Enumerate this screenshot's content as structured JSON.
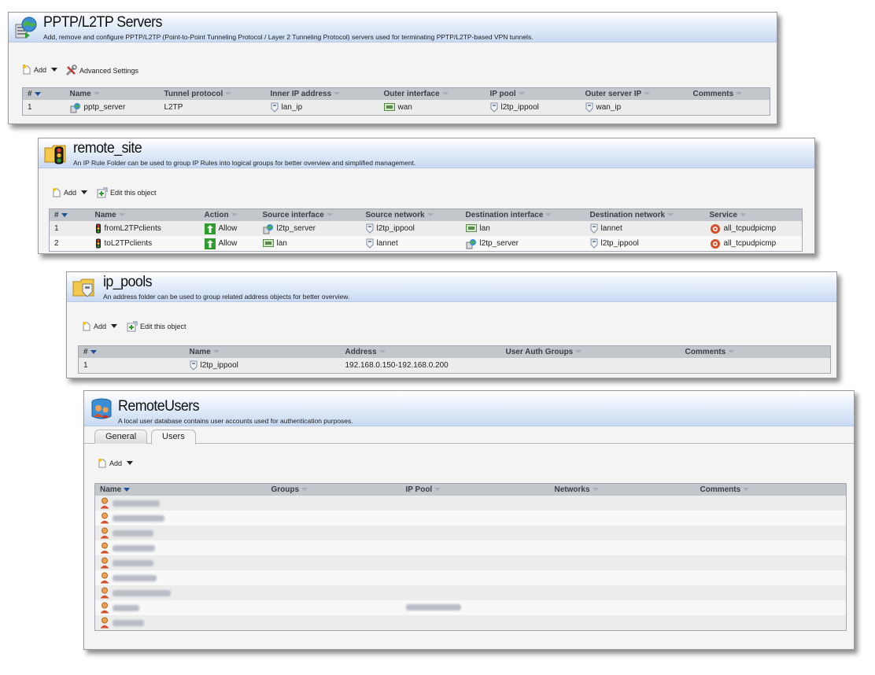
{
  "pptp_panel": {
    "title": "PPTP/L2TP Servers",
    "description": "Add, remove and configure PPTP/L2TP (Point-to-Point Tunneling Protocol / Layer 2 Tunneling Protocol) servers used for terminating PPTP/L2TP-based VPN tunnels.",
    "toolbar": {
      "add_label": "Add",
      "advanced_label": "Advanced Settings"
    },
    "columns": [
      "#",
      "Name",
      "Tunnel protocol",
      "Inner IP address",
      "Outer interface",
      "IP pool",
      "Outer server IP",
      "Comments"
    ],
    "rows": [
      {
        "index": "1",
        "name": "pptp_server",
        "protocol": "L2TP",
        "inner_ip": "lan_ip",
        "outer_interface": "wan",
        "ip_pool": "l2tp_ippool",
        "outer_server_ip": "wan_ip",
        "comments": ""
      }
    ]
  },
  "remote_site_panel": {
    "title": "remote_site",
    "description": "An IP Rule Folder can be used to group IP Rules into logical groups for better overview and simplified management.",
    "toolbar": {
      "add_label": "Add",
      "edit_label": "Edit this object"
    },
    "columns": [
      "#",
      "Name",
      "Action",
      "Source interface",
      "Source network",
      "Destination interface",
      "Destination network",
      "Service"
    ],
    "rows": [
      {
        "index": "1",
        "name": "fromL2TPclients",
        "action": "Allow",
        "src_if": "l2tp_server",
        "src_net": "l2tp_ippool",
        "dst_if": "lan",
        "dst_net": "lannet",
        "service": "all_tcpudpicmp"
      },
      {
        "index": "2",
        "name": "toL2TPclients",
        "action": "Allow",
        "src_if": "lan",
        "src_net": "lannet",
        "dst_if": "l2tp_server",
        "dst_net": "l2tp_ippool",
        "service": "all_tcpudpicmp"
      }
    ]
  },
  "ip_pools_panel": {
    "title": "ip_pools",
    "description": "An address folder can be used to group related address objects for better overview.",
    "toolbar": {
      "add_label": "Add",
      "edit_label": "Edit this object"
    },
    "columns": [
      "#",
      "Name",
      "Address",
      "User Auth Groups",
      "Comments"
    ],
    "rows": [
      {
        "index": "1",
        "name": "l2tp_ippool",
        "address": "192.168.0.150-192.168.0.200",
        "groups": "",
        "comments": ""
      }
    ]
  },
  "remote_users_panel": {
    "title": "RemoteUsers",
    "description": "A local user database contains user accounts used for authentication purposes.",
    "tabs": [
      {
        "label": "General"
      },
      {
        "label": "Users"
      }
    ],
    "toolbar": {
      "add_label": "Add"
    },
    "columns": [
      "Name",
      "Groups",
      "IP Pool",
      "Networks",
      "Comments"
    ],
    "user_count": 9
  },
  "icons": {
    "pptp_panel": "vpn-server-icon",
    "remote_site_panel": "rule-folder-icon",
    "ip_pools_panel": "address-folder-icon",
    "remote_users_panel": "user-database-icon",
    "user_row": "user-icon"
  },
  "colors": {
    "header_gradient_top": "#ffffff",
    "header_gradient_bottom": "#c9daf3",
    "table_header": "#c3c6ca",
    "allow_green": "#2e9d2e",
    "sort_blue": "#1c4f9c"
  }
}
